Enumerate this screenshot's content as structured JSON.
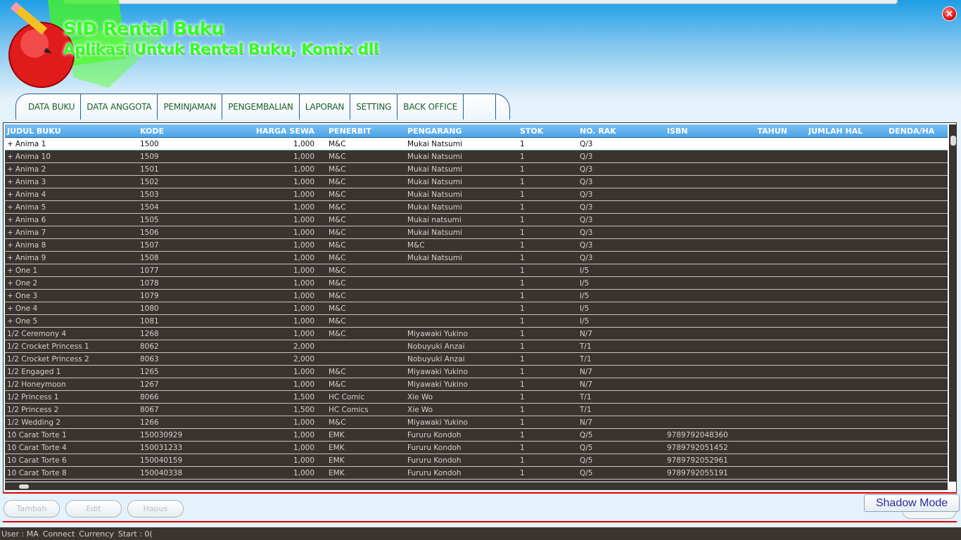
{
  "header": {
    "title": "SID Rental Buku",
    "subtitle": "Aplikasi Untuk Rental Buku, Komix dll",
    "close_label": "×"
  },
  "menu": [
    {
      "label": "DATA BUKU",
      "name": "menu-data-buku"
    },
    {
      "label": "DATA ANGGOTA",
      "name": "menu-data-anggota"
    },
    {
      "label": "PEMINJAMAN",
      "name": "menu-peminjaman"
    },
    {
      "label": "PENGEMBALIAN",
      "name": "menu-pengembalian"
    },
    {
      "label": "LAPORAN",
      "name": "menu-laporan"
    },
    {
      "label": "SETTING",
      "name": "menu-setting"
    },
    {
      "label": "BACK OFFICE",
      "name": "menu-back-office"
    }
  ],
  "table": {
    "columns": [
      "JUDUL BUKU",
      "KODE",
      "HARGA SEWA",
      "PENERBIT",
      "PENGARANG",
      "STOK",
      "NO. RAK",
      "ISBN",
      "TAHUN",
      "JUMLAH HAL",
      "DENDA/HA"
    ],
    "rows": [
      {
        "judul": "Anima 1",
        "plus": true,
        "kode": "1500",
        "harga": "1,000",
        "penerbit": "M&C",
        "pengarang": "Mukai Natsumi",
        "stok": "1",
        "rak": "Q/3",
        "isbn": ""
      },
      {
        "judul": "Anima 10",
        "plus": true,
        "kode": "1509",
        "harga": "1,000",
        "penerbit": "M&C",
        "pengarang": "Mukai Natsumi",
        "stok": "1",
        "rak": "Q/3",
        "isbn": ""
      },
      {
        "judul": "Anima 2",
        "plus": true,
        "kode": "1501",
        "harga": "1,000",
        "penerbit": "M&C",
        "pengarang": "Mukai Natsumi",
        "stok": "1",
        "rak": "Q/3",
        "isbn": ""
      },
      {
        "judul": "Anima 3",
        "plus": true,
        "kode": "1502",
        "harga": "1,000",
        "penerbit": "M&C",
        "pengarang": "Mukai Natsumi",
        "stok": "1",
        "rak": "Q/3",
        "isbn": ""
      },
      {
        "judul": "Anima 4",
        "plus": true,
        "kode": "1503",
        "harga": "1,000",
        "penerbit": "M&C",
        "pengarang": "Mukai Natsumi",
        "stok": "1",
        "rak": "Q/3",
        "isbn": ""
      },
      {
        "judul": "Anima 5",
        "plus": true,
        "kode": "1504",
        "harga": "1,000",
        "penerbit": "M&C",
        "pengarang": "Mukai Natsumi",
        "stok": "1",
        "rak": "Q/3",
        "isbn": ""
      },
      {
        "judul": "Anima 6",
        "plus": true,
        "kode": "1505",
        "harga": "1,000",
        "penerbit": "M&C",
        "pengarang": "Mukai natsumi",
        "stok": "1",
        "rak": "Q/3",
        "isbn": ""
      },
      {
        "judul": "Anima 7",
        "plus": true,
        "kode": "1506",
        "harga": "1,000",
        "penerbit": "M&C",
        "pengarang": "Mukai Natsumi",
        "stok": "1",
        "rak": "Q/3",
        "isbn": ""
      },
      {
        "judul": "Anima 8",
        "plus": true,
        "kode": "1507",
        "harga": "1,000",
        "penerbit": "M&C",
        "pengarang": "M&C",
        "stok": "1",
        "rak": "Q/3",
        "isbn": ""
      },
      {
        "judul": "Anima 9",
        "plus": true,
        "kode": "1508",
        "harga": "1,000",
        "penerbit": "M&C",
        "pengarang": "Mukai Natsumi",
        "stok": "1",
        "rak": "Q/3",
        "isbn": ""
      },
      {
        "judul": "One 1",
        "plus": true,
        "kode": "1077",
        "harga": "1,000",
        "penerbit": "M&C",
        "pengarang": "",
        "stok": "1",
        "rak": "I/5",
        "isbn": ""
      },
      {
        "judul": "One 2",
        "plus": true,
        "kode": "1078",
        "harga": "1,000",
        "penerbit": "M&C",
        "pengarang": "",
        "stok": "1",
        "rak": "I/5",
        "isbn": ""
      },
      {
        "judul": "One 3",
        "plus": true,
        "kode": "1079",
        "harga": "1,000",
        "penerbit": "M&C",
        "pengarang": "",
        "stok": "1",
        "rak": "I/5",
        "isbn": ""
      },
      {
        "judul": "One 4",
        "plus": true,
        "kode": "1080",
        "harga": "1,000",
        "penerbit": "M&C",
        "pengarang": "",
        "stok": "1",
        "rak": "I/5",
        "isbn": ""
      },
      {
        "judul": "One 5",
        "plus": true,
        "kode": "1081",
        "harga": "1,000",
        "penerbit": "M&C",
        "pengarang": "",
        "stok": "1",
        "rak": "I/5",
        "isbn": ""
      },
      {
        "judul": "1/2 Ceremony 4",
        "plus": false,
        "kode": "1268",
        "harga": "1,000",
        "penerbit": "M&C",
        "pengarang": "Miyawaki Yukino",
        "stok": "1",
        "rak": "N/7",
        "isbn": ""
      },
      {
        "judul": "1/2 Crocket Princess 1",
        "plus": false,
        "kode": "8062",
        "harga": "2,000",
        "penerbit": "",
        "pengarang": "Nobuyuki Anzai",
        "stok": "1",
        "rak": "T/1",
        "isbn": ""
      },
      {
        "judul": "1/2 Crocket Princess 2",
        "plus": false,
        "kode": "8063",
        "harga": "2,000",
        "penerbit": "",
        "pengarang": "Nobuyuki Anzai",
        "stok": "1",
        "rak": "T/1",
        "isbn": ""
      },
      {
        "judul": "1/2 Engaged 1",
        "plus": false,
        "kode": "1265",
        "harga": "1,000",
        "penerbit": "M&C",
        "pengarang": "Miyawaki Yukino",
        "stok": "1",
        "rak": "N/7",
        "isbn": ""
      },
      {
        "judul": "1/2 Honeymoon",
        "plus": false,
        "kode": "1267",
        "harga": "1,000",
        "penerbit": "M&C",
        "pengarang": "Miyawaki Yukino",
        "stok": "1",
        "rak": "N/7",
        "isbn": ""
      },
      {
        "judul": "1/2 Princess 1",
        "plus": false,
        "kode": "8066",
        "harga": "1,500",
        "penerbit": "HC Comic",
        "pengarang": "Xie Wo",
        "stok": "1",
        "rak": "T/1",
        "isbn": ""
      },
      {
        "judul": "1/2 Princess 2",
        "plus": false,
        "kode": "8067",
        "harga": "1,500",
        "penerbit": "HC Comics",
        "pengarang": "Xie Wo",
        "stok": "1",
        "rak": "T/1",
        "isbn": ""
      },
      {
        "judul": "1/2 Wedding 2",
        "plus": false,
        "kode": "1266",
        "harga": "1,000",
        "penerbit": "M&C",
        "pengarang": "Miyawaki Yukino",
        "stok": "1",
        "rak": "N/7",
        "isbn": ""
      },
      {
        "judul": "10 Carat Torte 1",
        "plus": false,
        "kode": "150030929",
        "harga": "1,000",
        "penerbit": "EMK",
        "pengarang": "Fururu Kondoh",
        "stok": "1",
        "rak": "Q/5",
        "isbn": "9789792048360"
      },
      {
        "judul": "10 Carat Torte 4",
        "plus": false,
        "kode": "150031233",
        "harga": "1,000",
        "penerbit": "EMK",
        "pengarang": "Fururu Kondoh",
        "stok": "1",
        "rak": "Q/5",
        "isbn": "9789792051452"
      },
      {
        "judul": "10 Carat Torte 6",
        "plus": false,
        "kode": "150040159",
        "harga": "1,000",
        "penerbit": "EMK",
        "pengarang": "Fururu Kondoh",
        "stok": "1",
        "rak": "Q/5",
        "isbn": "9789792052961"
      },
      {
        "judul": "10 Carat Torte 8",
        "plus": false,
        "kode": "150040338",
        "harga": "1,000",
        "penerbit": "EMK",
        "pengarang": "Fururu Kondoh",
        "stok": "1",
        "rak": "Q/5",
        "isbn": "9789792055191"
      }
    ]
  },
  "buttons": {
    "tambah": "Tambah",
    "edit": "Edit",
    "hapus": "Hapus",
    "shadow_mode": "Shadow Mode"
  },
  "status": {
    "user": "User : MA",
    "connect": "Connect",
    "currency": "Currency",
    "start": "Start : 0("
  },
  "colors": {
    "grid_bg": "#3a3431",
    "header_blue": "#4aa4ea",
    "title_green": "#33ff22",
    "accent_red": "#e00000"
  }
}
